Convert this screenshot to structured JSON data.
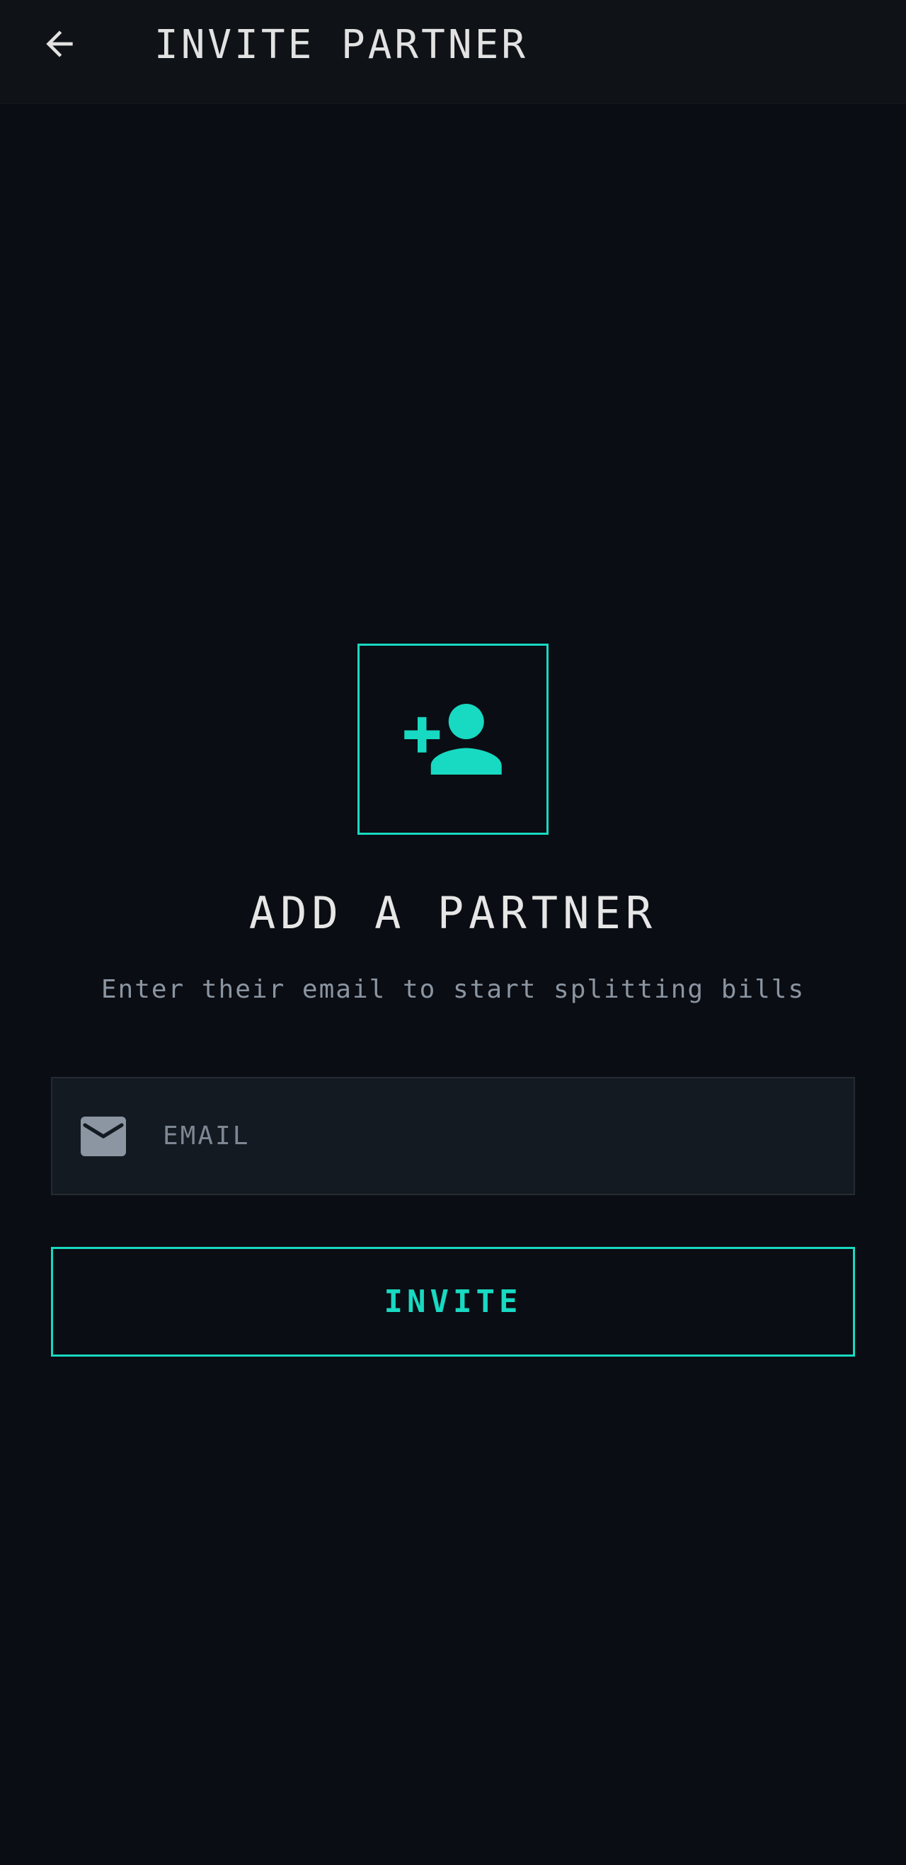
{
  "app_bar": {
    "title": "INVITE PARTNER",
    "back_icon": "arrow-left-icon"
  },
  "hero": {
    "icon": "person-add-icon",
    "heading": "ADD A PARTNER",
    "subtitle": "Enter their email to start splitting bills"
  },
  "form": {
    "email_icon": "mail-icon",
    "email_placeholder": "EMAIL",
    "email_value": "",
    "invite_label": "INVITE"
  },
  "colors": {
    "background": "#0a0d13",
    "app_bar": "#0f1317",
    "accent": "#18d9c2",
    "text_primary": "#e6e6e6",
    "text_secondary": "#8b95a1",
    "field_background": "#141a21"
  }
}
